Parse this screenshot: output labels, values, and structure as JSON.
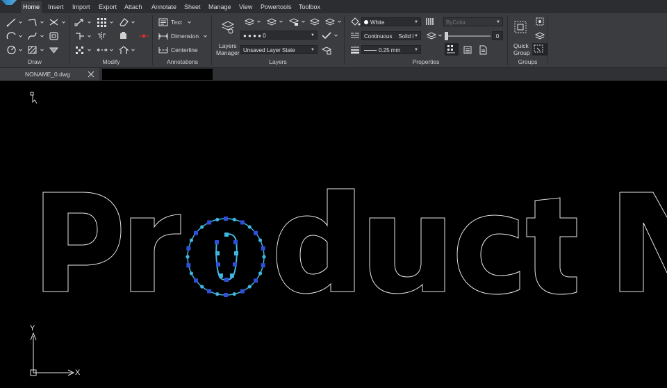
{
  "menu_tabs": [
    "Home",
    "Insert",
    "Import",
    "Export",
    "Attach",
    "Annotate",
    "Sheet",
    "Manage",
    "View",
    "Powertools",
    "Toolbox"
  ],
  "ribbon": {
    "groups": [
      "Draw",
      "Modify",
      "Annotations",
      "Layers",
      "Properties",
      "Groups"
    ],
    "annotations": {
      "text_label": "Text",
      "dimension_label": "Dimension",
      "centerline_label": "Centerline"
    },
    "layers": {
      "manager_label_1": "Layers",
      "manager_label_2": "Manager",
      "current_layer": "0",
      "layer_state": "Unsaved Layer State"
    },
    "properties": {
      "color": "White",
      "linetype": "Continuous",
      "linetype_style": "Solid l",
      "lineweight": "0.25 mm",
      "transparency_mode": "ByColor",
      "transparency_value": "0"
    },
    "groups_panel": {
      "quick_group_1": "Quick",
      "quick_group_2": "Group"
    }
  },
  "document": {
    "tab_name": "NONAME_0.dwg"
  },
  "canvas": {
    "x_axis_label": "X",
    "y_axis_label": "Y"
  },
  "colors": {
    "selection_grip": "#2f4fd8",
    "selection_line": "#3fb6e0",
    "outline": "#e8e8e8"
  }
}
